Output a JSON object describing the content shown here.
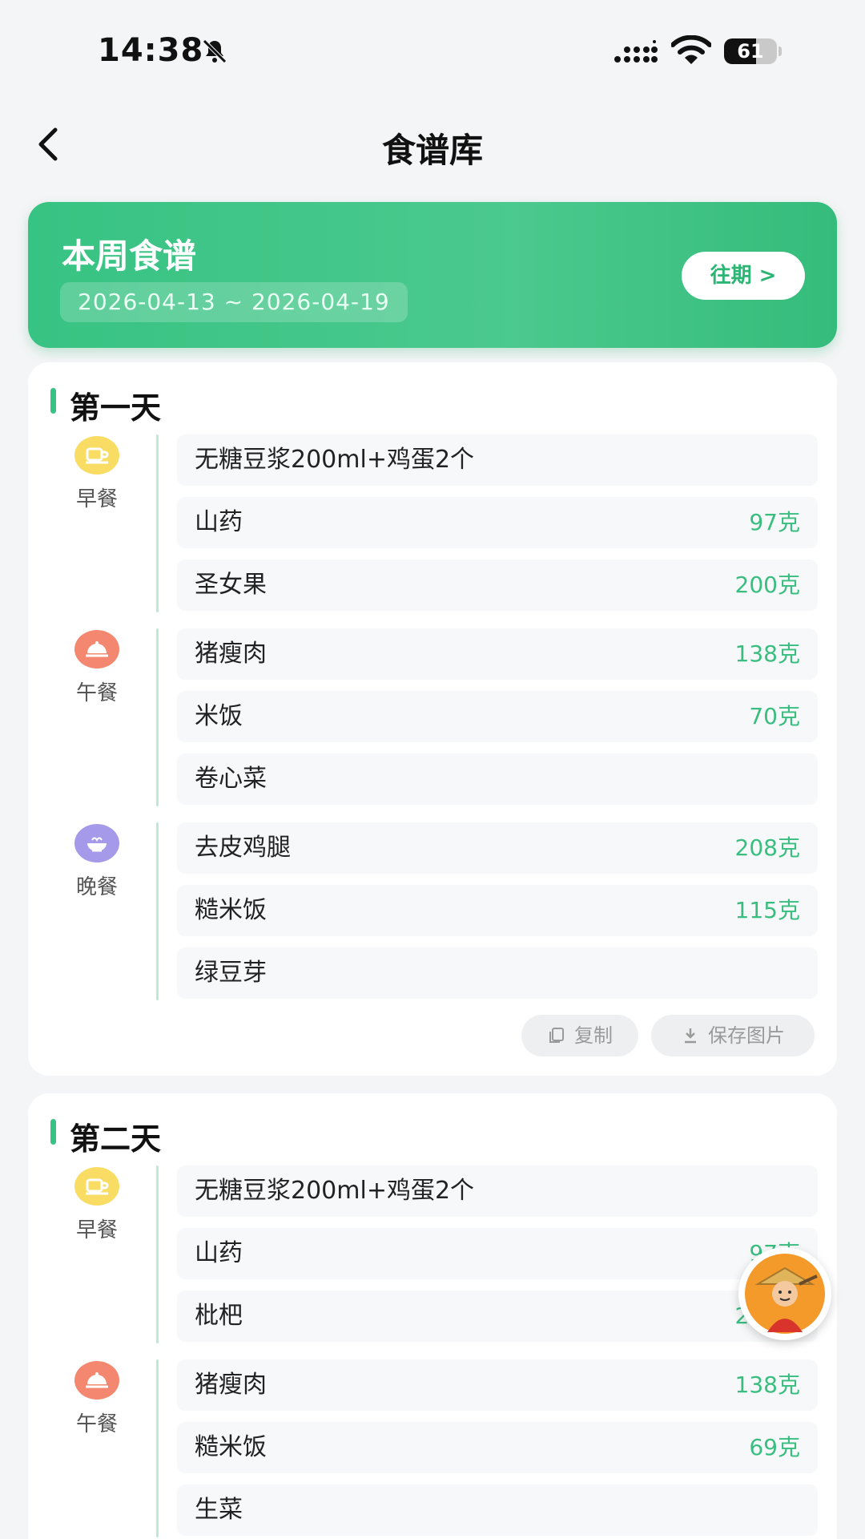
{
  "status_bar": {
    "time": "14:38",
    "battery": "61",
    "battery_level": 0.61
  },
  "nav": {
    "title": "食谱库"
  },
  "banner": {
    "title": "本周食谱",
    "date_range": "2026-04-13 ~ 2026-04-19",
    "history_label": "往期 >"
  },
  "days": [
    {
      "title": "第一天",
      "meals": [
        {
          "label": "早餐",
          "icon": "breakfast-icon",
          "items": [
            {
              "name": "无糖豆浆200ml+鸡蛋2个",
              "amount": ""
            },
            {
              "name": "山药",
              "amount": "97克"
            },
            {
              "name": "圣女果",
              "amount": "200克"
            }
          ]
        },
        {
          "label": "午餐",
          "icon": "lunch-icon",
          "items": [
            {
              "name": "猪瘦肉",
              "amount": "138克"
            },
            {
              "name": "米饭",
              "amount": "70克"
            },
            {
              "name": "卷心菜",
              "amount": ""
            }
          ]
        },
        {
          "label": "晚餐",
          "icon": "dinner-icon",
          "items": [
            {
              "name": "去皮鸡腿",
              "amount": "208克"
            },
            {
              "name": "糙米饭",
              "amount": "115克"
            },
            {
              "name": "绿豆芽",
              "amount": ""
            }
          ]
        }
      ],
      "actions": {
        "copy": "复制",
        "save_image": "保存图片"
      }
    },
    {
      "title": "第二天",
      "meals": [
        {
          "label": "早餐",
          "icon": "breakfast-icon",
          "items": [
            {
              "name": "无糖豆浆200ml+鸡蛋2个",
              "amount": ""
            },
            {
              "name": "山药",
              "amount": "97克"
            },
            {
              "name": "枇杷",
              "amount": "200克"
            }
          ]
        },
        {
          "label": "午餐",
          "icon": "lunch-icon",
          "items": [
            {
              "name": "猪瘦肉",
              "amount": "138克"
            },
            {
              "name": "糙米饭",
              "amount": "69克"
            },
            {
              "name": "生菜",
              "amount": ""
            }
          ]
        }
      ]
    }
  ],
  "colors": {
    "accent": "#37c383",
    "breakfast": "#f9dc64",
    "lunch": "#f38770",
    "dinner": "#a49ae9"
  }
}
